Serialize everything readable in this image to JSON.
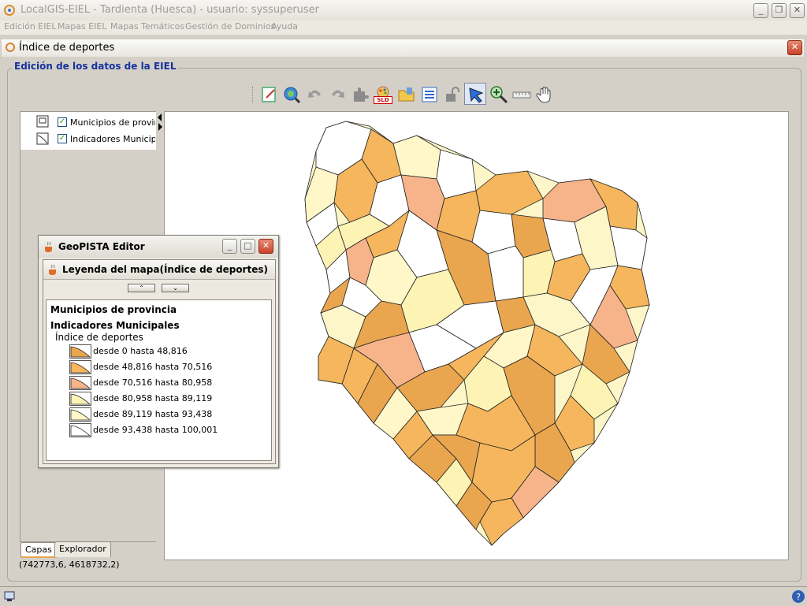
{
  "app": {
    "title": "LocalGIS-EIEL - Tardienta (Huesca) - usuario: syssuperuser",
    "menu": [
      "Edición EIEL",
      "Mapas EIEL",
      "Mapas Temáticos",
      "Gestión de Dominios",
      "Ayuda"
    ]
  },
  "frame": {
    "title": "Índice de deportes",
    "group_title": "Edición de los datos de la EIEL"
  },
  "toolbar": {
    "icons": [
      "edit-icon",
      "globe-search-icon",
      "undo-icon",
      "redo-icon",
      "puzzle-icon",
      "sld-icon",
      "folder-icon",
      "list-icon",
      "lock-icon",
      "select-arrow-icon",
      "zoom-in-icon",
      "ruler-icon",
      "pan-hand-icon"
    ],
    "sld_label": "SLD"
  },
  "layers": {
    "items": [
      {
        "label": "Municipios de provincia",
        "checked": true
      },
      {
        "label": "Indicadores Municipales",
        "checked": true
      }
    ],
    "tabs": [
      "Capas",
      "Explorador"
    ]
  },
  "status": {
    "coords": "(742773,6, 4618732,2)"
  },
  "legend": {
    "window_title": "GeoPISTA Editor",
    "panel_title": "Leyenda del mapa(Índice de deportes)",
    "heading1": "Municipios de provincia",
    "heading2": "Indicadores Municipales",
    "subheading": "Índice de deportes",
    "items": [
      {
        "label": "desde 0 hasta 48,816",
        "color": "#e9a64f"
      },
      {
        "label": "desde 48,816 hasta 70,516",
        "color": "#f5b65d"
      },
      {
        "label": "desde 70,516 hasta 80,958",
        "color": "#f7b48a"
      },
      {
        "label": "desde 80,958 hasta 89,119",
        "color": "#fdf3b4"
      },
      {
        "label": "desde 89,119 hasta 93,438",
        "color": "#fff7c8"
      },
      {
        "label": "desde 93,438 hasta 100,001",
        "color": "#ffffff"
      }
    ]
  }
}
